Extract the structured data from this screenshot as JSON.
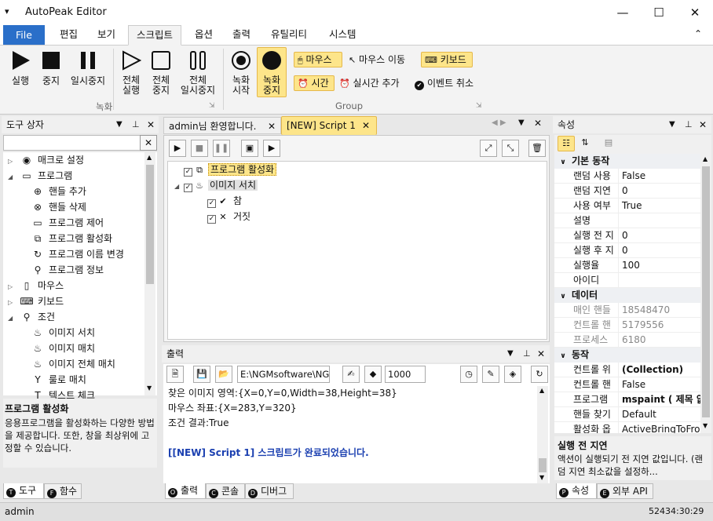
{
  "window": {
    "title": "AutoPeak Editor",
    "minimize": "—",
    "maximize": "☐",
    "close": "✕",
    "menu_glyph": "▾",
    "collapse": "⌃"
  },
  "menu_tabs": [
    "File",
    "편집",
    "보기",
    "스크립트",
    "옵션",
    "출력",
    "유틸리티",
    "시스템"
  ],
  "ribbon": {
    "run": "실행",
    "stop": "중지",
    "pause": "일시중지",
    "run_all": "전체\n실행",
    "stop_all": "전체\n중지",
    "pause_all": "전체\n일시중지",
    "rec_start": "녹화\n시작",
    "rec_stop": "녹화\n중지",
    "mouse": "마우스",
    "mouse_move": "마우스 이동",
    "keyboard": "키보드",
    "time": "시간",
    "realtime_add": "실시간 추가",
    "event_cancel": "이벤트 취소",
    "group_record": "녹화",
    "group_group": "Group"
  },
  "toolbox": {
    "title": "도구 상자",
    "items": [
      {
        "label": "매크로 설정",
        "level": 1,
        "exp": "▷",
        "icon": "◉"
      },
      {
        "label": "프로그램",
        "level": 1,
        "exp": "◢",
        "icon": "▭"
      },
      {
        "label": "핸들 추가",
        "level": 2,
        "icon": "⊕"
      },
      {
        "label": "핸들 삭제",
        "level": 2,
        "icon": "⊗"
      },
      {
        "label": "프로그램 제어",
        "level": 2,
        "icon": "▭"
      },
      {
        "label": "프로그램 활성화",
        "level": 2,
        "icon": "⧉"
      },
      {
        "label": "프로그램 이름 변경",
        "level": 2,
        "icon": "↻"
      },
      {
        "label": "프로그램 정보",
        "level": 2,
        "icon": "⚲"
      },
      {
        "label": "마우스",
        "level": 1,
        "exp": "▷",
        "icon": "▯"
      },
      {
        "label": "키보드",
        "level": 1,
        "exp": "▷",
        "icon": "⌨"
      },
      {
        "label": "조건",
        "level": 1,
        "exp": "◢",
        "icon": "⚲"
      },
      {
        "label": "이미지 서치",
        "level": 2,
        "icon": "♨"
      },
      {
        "label": "이미지 매치",
        "level": 2,
        "icon": "♨"
      },
      {
        "label": "이미지 전체 매치",
        "level": 2,
        "icon": "♨"
      },
      {
        "label": "룰로 매치",
        "level": 2,
        "icon": "Y"
      },
      {
        "label": "텍스트 체크",
        "level": 2,
        "icon": "T"
      }
    ],
    "desc_title": "프로그램 활성화",
    "desc_text": "응용프로그램을 활성화하는 다양한 방법을 제공합니다. 또한, 창을 최상위에 고정할 수 있습니다.",
    "tabs": [
      "도구",
      "함수"
    ],
    "tab_icons": [
      "T",
      "F"
    ]
  },
  "editor": {
    "tabs": [
      "admin님 환영합니다.",
      "[NEW] Script 1"
    ],
    "nodes": [
      {
        "label": "프로그램 활성화",
        "level": 0,
        "icon": "⧉",
        "highlight": true
      },
      {
        "label": "이미지 서치",
        "level": 0,
        "icon": "♨",
        "exp": "◢"
      },
      {
        "label": "참",
        "level": 1,
        "icon": "✔"
      },
      {
        "label": "거짓",
        "level": 1,
        "icon": "✕"
      }
    ]
  },
  "output": {
    "title": "출력",
    "path": "E:\\NGMsoftware\\NG",
    "interval": "1000",
    "lines": [
      "찾은 이미지 영역:{X=0,Y=0,Width=38,Height=38}",
      "마우스 좌표:{X=283,Y=320}",
      "조건 결과:True",
      "",
      "[[NEW] Script 1] 스크립트가 완료되었습니다."
    ],
    "tabs": [
      "출력",
      "콘솔",
      "디버그"
    ],
    "tab_icons": [
      "O",
      "C",
      "D"
    ]
  },
  "properties": {
    "title": "속성",
    "categories": [
      {
        "name": "기본 동작",
        "rows": [
          [
            "랜덤 사용",
            "False"
          ],
          [
            "랜덤 지연",
            "0"
          ],
          [
            "사용 여부",
            "True"
          ],
          [
            "설명",
            ""
          ],
          [
            "실행 전 지",
            "0"
          ],
          [
            "실행 후 지",
            "0"
          ],
          [
            "실행율",
            "100"
          ],
          [
            "아이디",
            ""
          ]
        ]
      },
      {
        "name": "데이터",
        "rows": [
          [
            "매인 핸들",
            "18548470"
          ],
          [
            "컨트롤 핸",
            "5179556"
          ],
          [
            "프로세스",
            "6180"
          ]
        ]
      },
      {
        "name": "동작",
        "rows": [
          [
            "컨트롤 위",
            "(Collection)"
          ],
          [
            "컨트롤 핸",
            "False"
          ],
          [
            "프로그램",
            "mspaint ( 제목 없"
          ],
          [
            "핸들 찾기",
            "Default"
          ],
          [
            "활성화 옵",
            "ActiveBringToFror"
          ]
        ]
      }
    ],
    "desc_title": "실행 전 지연",
    "desc_text": "액션이 실행되기 전 지연 값입니다. (랜덤 지연 최소값을 설정하...",
    "tabs": [
      "속성",
      "외부 API"
    ],
    "tab_icons": [
      "P",
      "E"
    ]
  },
  "status": {
    "user": "admin",
    "time": "52434:30:29"
  }
}
